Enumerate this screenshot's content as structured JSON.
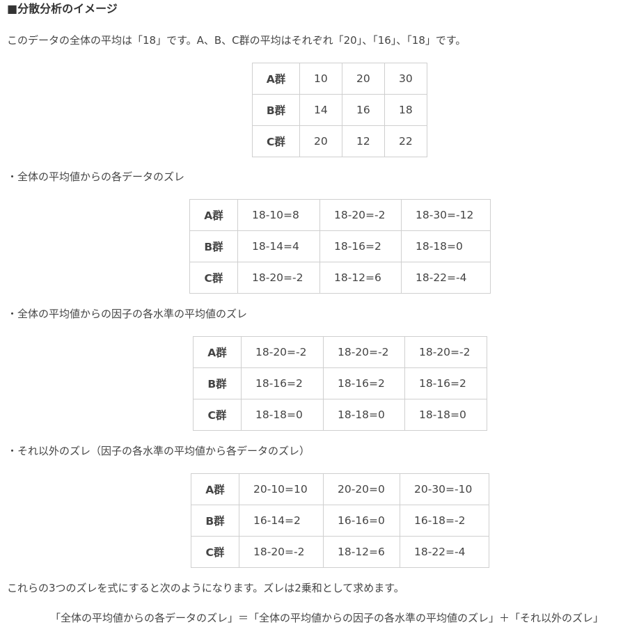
{
  "heading": "■分散分析のイメージ",
  "intro": "このデータの全体の平均は「18」です。A、B、C群の平均はそれぞれ「20」、「16」、「18」です。",
  "tables": [
    {
      "rows": [
        {
          "label": "A群",
          "cells": [
            "10",
            "20",
            "30"
          ]
        },
        {
          "label": "B群",
          "cells": [
            "14",
            "16",
            "18"
          ]
        },
        {
          "label": "C群",
          "cells": [
            "20",
            "12",
            "22"
          ]
        }
      ]
    },
    {
      "caption": "・全体の平均値からの各データのズレ",
      "rows": [
        {
          "label": "A群",
          "cells": [
            "18-10=8",
            "18-20=-2",
            "18-30=-12"
          ]
        },
        {
          "label": "B群",
          "cells": [
            "18-14=4",
            "18-16=2",
            "18-18=0"
          ]
        },
        {
          "label": "C群",
          "cells": [
            "18-20=-2",
            "18-12=6",
            "18-22=-4"
          ]
        }
      ]
    },
    {
      "caption": "・全体の平均値からの因子の各水準の平均値のズレ",
      "rows": [
        {
          "label": "A群",
          "cells": [
            "18-20=-2",
            "18-20=-2",
            "18-20=-2"
          ]
        },
        {
          "label": "B群",
          "cells": [
            "18-16=2",
            "18-16=2",
            "18-16=2"
          ]
        },
        {
          "label": "C群",
          "cells": [
            "18-18=0",
            "18-18=0",
            "18-18=0"
          ]
        }
      ]
    },
    {
      "caption": "・それ以外のズレ（因子の各水準の平均値から各データのズレ）",
      "rows": [
        {
          "label": "A群",
          "cells": [
            "20-10=10",
            "20-20=0",
            "20-30=-10"
          ]
        },
        {
          "label": "B群",
          "cells": [
            "16-14=2",
            "16-16=0",
            "16-18=-2"
          ]
        },
        {
          "label": "C群",
          "cells": [
            "18-20=-2",
            "18-12=6",
            "18-22=-4"
          ]
        }
      ]
    }
  ],
  "summary": "これらの3つのズレを式にすると次のようになります。ズレは2乗和として求めます。",
  "formula": "「全体の平均値からの各データのズレ」＝「全体の平均値からの因子の各水準の平均値のズレ」＋「それ以外のズレ」"
}
